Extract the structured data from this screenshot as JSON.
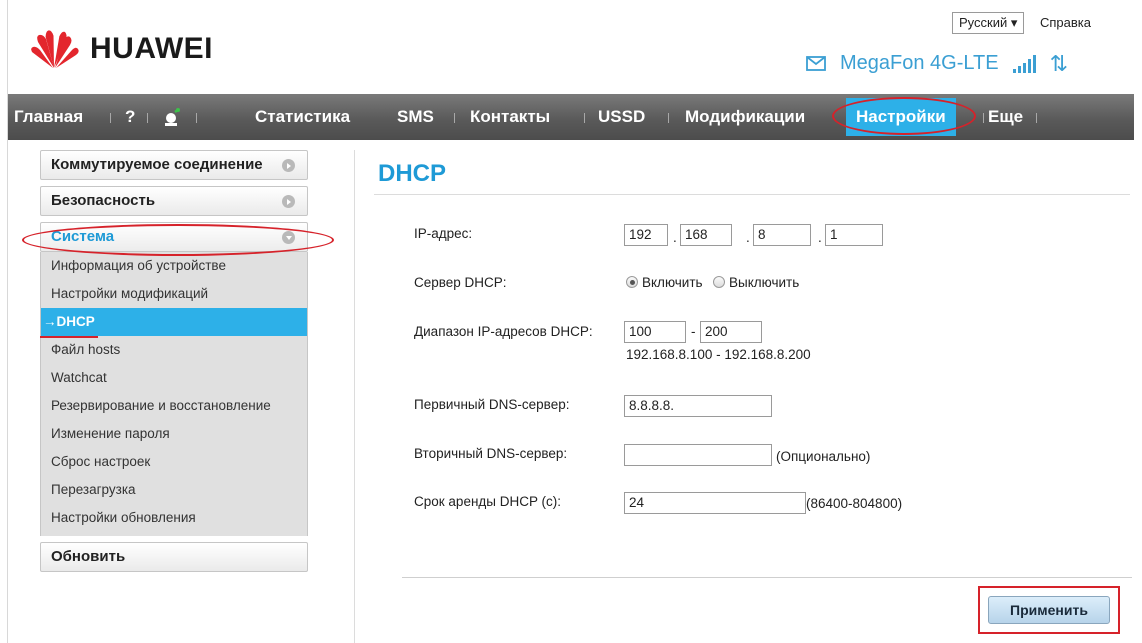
{
  "header": {
    "language": "Русский ▾",
    "help": "Справка",
    "brand": "HUAWEI",
    "operator": "MegaFon 4G-LTE"
  },
  "nav": {
    "home": "Главная",
    "help": "?",
    "stats": "Статистика",
    "sms": "SMS",
    "contacts": "Контакты",
    "ussd": "USSD",
    "mods": "Модификации",
    "settings": "Настройки",
    "more": "Еще"
  },
  "sidebar": {
    "dialup": "Коммутируемое соединение",
    "security": "Безопасность",
    "system": "Система",
    "items": [
      "Информация об устройстве",
      "Настройки модификаций",
      "→DHCP",
      "Файл hosts",
      "Watchcat",
      "Резервирование и восстановление",
      "Изменение пароля",
      "Сброс настроек",
      "Перезагрузка",
      "Настройки обновления"
    ],
    "update": "Обновить"
  },
  "main": {
    "title": "DHCP",
    "ip_label": "IP-адрес:",
    "ip": [
      "192",
      "168",
      "8",
      "1"
    ],
    "dhcp_server_label": "Сервер DHCP:",
    "enable": "Включить",
    "disable": "Выключить",
    "range_label": "Диапазон IP-адресов DHCP:",
    "range_start": "100",
    "range_end": "200",
    "range_text": "192.168.8.100 - 192.168.8.200",
    "dns1_label": "Первичный DNS-сервер:",
    "dns1": "8.8.8.8.",
    "dns2_label": "Вторичный DNS-сервер:",
    "dns2": "",
    "optional": "(Опционально)",
    "lease_label": "Срок аренды DHCP (с):",
    "lease": "24",
    "lease_range": "(86400-804800)",
    "apply": "Применить"
  },
  "colors": {
    "accent": "#2db0e8",
    "title": "#1e9ad6",
    "highlight": "#d6222a"
  }
}
